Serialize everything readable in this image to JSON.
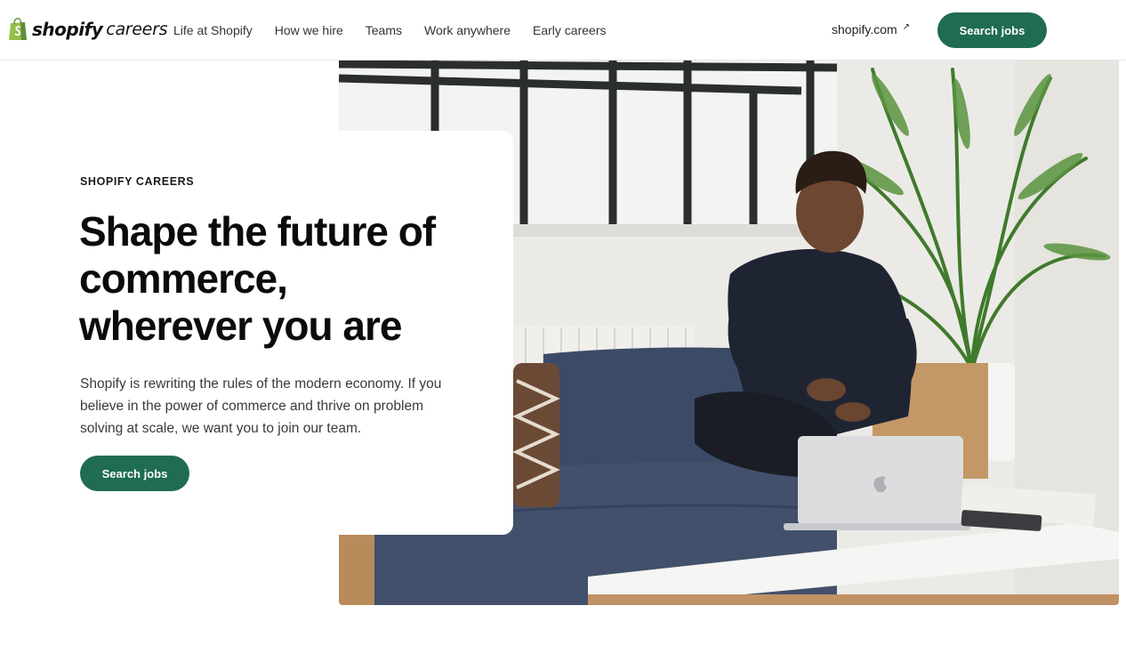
{
  "brand": {
    "logo_word": "shopify",
    "logo_sub": "careers",
    "accent_color": "#1f6b53"
  },
  "nav": {
    "links": [
      {
        "label": "Life at Shopify"
      },
      {
        "label": "How we hire"
      },
      {
        "label": "Teams"
      },
      {
        "label": "Work anywhere"
      },
      {
        "label": "Early careers"
      }
    ],
    "site_link": "shopify.com",
    "site_link_icon": "external-arrow-icon",
    "cta_label": "Search jobs"
  },
  "hero": {
    "eyebrow": "SHOPIFY CAREERS",
    "headline": "Shape the future of commerce, wherever you are",
    "body": "Shopify is rewriting the rules of the modern economy. If you believe in the power of commerce and thrive on problem solving at scale, we want you to join our team.",
    "cta_label": "Search jobs"
  }
}
